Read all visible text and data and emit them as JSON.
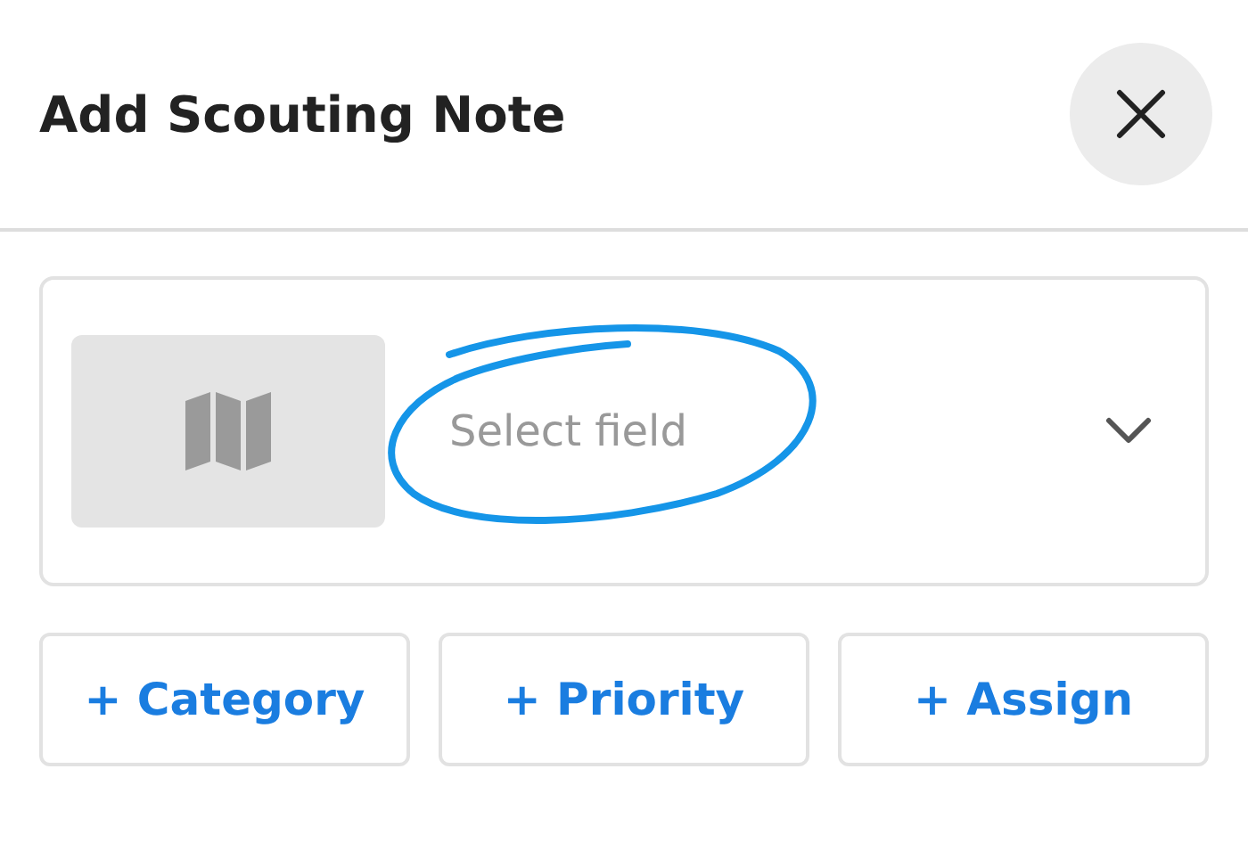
{
  "title": "Add Scouting Note",
  "field_select": {
    "placeholder": "Select field",
    "annotation": {
      "kind": "circle"
    }
  },
  "chips": [
    {
      "label": "+ Category"
    },
    {
      "label": "+ Priority"
    },
    {
      "label": "+ Assign"
    }
  ]
}
